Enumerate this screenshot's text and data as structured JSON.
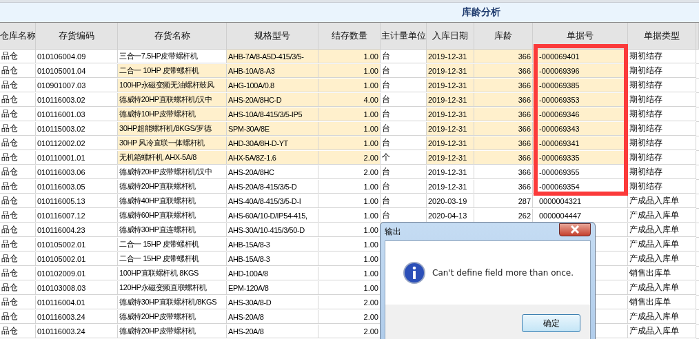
{
  "report_title": "库龄分析",
  "columns": [
    "仓库名称",
    "存货编码",
    "存货名称",
    "规格型号",
    "结存数量",
    "主计量单位",
    "入库日期",
    "库龄",
    "单据号",
    "单据类型"
  ],
  "rows": [
    {
      "warehouse": "品仓",
      "code": "010106004.09",
      "name": "三合一7.5HP皮带螺杆机",
      "spec": "AHB-7A/8-A5D-415/3/5-",
      "qty": "1.00",
      "unit": "台",
      "date": "2019-12-31",
      "age": "366",
      "doc_no": "-000069401",
      "doc_type": "期初结存",
      "highlighted": true,
      "name_highlighted": false
    },
    {
      "warehouse": "品仓",
      "code": "010105001.04",
      "name": "二合一 10HP 皮带螺杆机",
      "spec": "AHB-10A/8-A3",
      "qty": "1.00",
      "unit": "台",
      "date": "2019-12-31",
      "age": "366",
      "doc_no": "-000069396",
      "doc_type": "期初结存",
      "highlighted": true,
      "name_highlighted": true
    },
    {
      "warehouse": "品仓",
      "code": "010901007.03",
      "name": "100HP永磁变频无油螺杆鼓风",
      "spec": "AHG-100A/0.8",
      "qty": "1.00",
      "unit": "台",
      "date": "2019-12-31",
      "age": "366",
      "doc_no": "-000069385",
      "doc_type": "期初结存",
      "highlighted": true,
      "name_highlighted": true
    },
    {
      "warehouse": "品仓",
      "code": "010116003.02",
      "name": "德威特20HP直联螺杆机/汉中",
      "spec": "AHS-20A/8HC-D",
      "qty": "4.00",
      "unit": "台",
      "date": "2019-12-31",
      "age": "366",
      "doc_no": "-000069353",
      "doc_type": "期初结存",
      "highlighted": true,
      "name_highlighted": true
    },
    {
      "warehouse": "品仓",
      "code": "010116001.03",
      "name": "德威特10HP皮带螺杆机",
      "spec": "AHS-10A/8-415/3/5-IP5",
      "qty": "1.00",
      "unit": "台",
      "date": "2019-12-31",
      "age": "366",
      "doc_no": "-000069346",
      "doc_type": "期初结存",
      "highlighted": true,
      "name_highlighted": true
    },
    {
      "warehouse": "品仓",
      "code": "010115003.02",
      "name": "30HP超能螺杆机/8KGS/罗德",
      "spec": "SPM-30A/8E",
      "qty": "1.00",
      "unit": "台",
      "date": "2019-12-31",
      "age": "366",
      "doc_no": "-000069343",
      "doc_type": "期初结存",
      "highlighted": true,
      "name_highlighted": true
    },
    {
      "warehouse": "品仓",
      "code": "010112002.02",
      "name": "30HP 风冷直联一体螺杆机",
      "spec": "AHD-30A/8H-D-YT",
      "qty": "1.00",
      "unit": "台",
      "date": "2019-12-31",
      "age": "366",
      "doc_no": "-000069341",
      "doc_type": "期初结存",
      "highlighted": true,
      "name_highlighted": true
    },
    {
      "warehouse": "品仓",
      "code": "010110001.01",
      "name": "无机箱螺杆机 AHX-5A/8",
      "spec": "AHX-5A/8Z-1.6",
      "qty": "2.00",
      "unit": "个",
      "date": "2019-12-31",
      "age": "366",
      "doc_no": "-000069335",
      "doc_type": "期初结存",
      "highlighted": true,
      "name_highlighted": true
    },
    {
      "warehouse": "品仓",
      "code": "010116003.06",
      "name": "德威特20HP皮带螺杆机/汉中",
      "spec": "AHS-20A/8HC",
      "qty": "2.00",
      "unit": "台",
      "date": "2019-12-31",
      "age": "366",
      "doc_no": "-000069355",
      "doc_type": "期初结存",
      "highlighted": false,
      "name_highlighted": false
    },
    {
      "warehouse": "品仓",
      "code": "010116003.05",
      "name": "德威特20HP直联螺杆机",
      "spec": "AHS-20A/8-415/3/5-D",
      "qty": "1.00",
      "unit": "台",
      "date": "2019-12-31",
      "age": "366",
      "doc_no": "-000069354",
      "doc_type": "期初结存",
      "highlighted": false,
      "name_highlighted": false
    },
    {
      "warehouse": "品仓",
      "code": "010116005.13",
      "name": "德威特40HP直联螺杆机",
      "spec": "AHS-40A/8-415/3/5-D-I",
      "qty": "1.00",
      "unit": "台",
      "date": "2020-03-19",
      "age": "287",
      "doc_no": "0000004321",
      "doc_type": "产成品入库单",
      "highlighted": false,
      "name_highlighted": false
    },
    {
      "warehouse": "品仓",
      "code": "010116007.12",
      "name": "德威特60HP直联螺杆机",
      "spec": "AHS-60A/10-D/IP54-415,",
      "qty": "1.00",
      "unit": "台",
      "date": "2020-04-13",
      "age": "262",
      "doc_no": "0000004447",
      "doc_type": "产成品入库单",
      "highlighted": false,
      "name_highlighted": false
    },
    {
      "warehouse": "品仓",
      "code": "010116004.23",
      "name": "德威特30HP直连螺杆机",
      "spec": "AHS-30A/10-415/3/50-D",
      "qty": "1.00",
      "doc_type": "产成品入库单",
      "highlighted": false,
      "name_highlighted": false
    },
    {
      "warehouse": "品仓",
      "code": "010105002.01",
      "name": "二合一 15HP 皮带螺杆机",
      "spec": "AHB-15A/8-3",
      "qty": "1.00",
      "doc_type": "产成品入库单",
      "highlighted": false,
      "name_highlighted": false
    },
    {
      "warehouse": "品仓",
      "code": "010105002.01",
      "name": "二合一 15HP 皮带螺杆机",
      "spec": "AHB-15A/8-3",
      "qty": "1.00",
      "doc_type": "产成品入库单",
      "highlighted": false,
      "name_highlighted": false
    },
    {
      "warehouse": "品仓",
      "code": "010102009.01",
      "name": "100HP直联螺杆机 8KGS",
      "spec": "AHD-100A/8",
      "qty": "1.00",
      "doc_type": "销售出库单",
      "highlighted": false,
      "name_highlighted": false
    },
    {
      "warehouse": "品仓",
      "code": "010103008.03",
      "name": "120HP永磁变频直联螺杆机",
      "spec": "EPM-120A/8",
      "qty": "1.00",
      "doc_type": "产成品入库单",
      "highlighted": false,
      "name_highlighted": false
    },
    {
      "warehouse": "品仓",
      "code": "010116004.01",
      "name": "德威特30HP直联螺杆机/8KGS",
      "spec": "AHS-30A/8-D",
      "qty": "2.00",
      "doc_type": "销售出库单",
      "highlighted": false,
      "name_highlighted": false
    },
    {
      "warehouse": "品仓",
      "code": "010116003.24",
      "name": "德威特20HP皮带螺杆机",
      "spec": "AHS-20A/8",
      "qty": "2.00",
      "doc_type": "产成品入库单",
      "highlighted": false,
      "name_highlighted": false
    },
    {
      "warehouse": "品仓",
      "code": "010116003.24",
      "name": "德威特20HP皮带螺杆机",
      "spec": "AHS-20A/8",
      "qty": "2.00",
      "doc_type": "产成品入库单",
      "highlighted": false,
      "name_highlighted": false
    }
  ],
  "dialog": {
    "title": "输出",
    "message": "Can't define field more than once.",
    "button": "确定"
  }
}
